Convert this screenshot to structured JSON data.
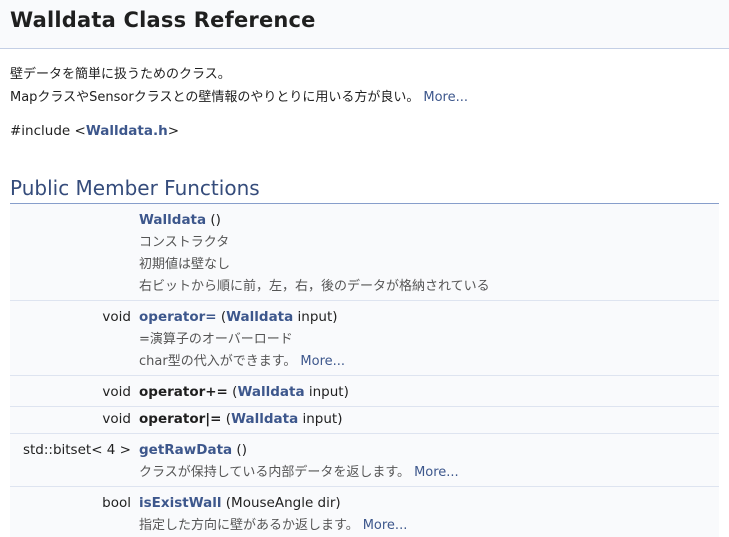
{
  "header": {
    "title": "Walldata Class Reference"
  },
  "brief": {
    "line1": "壁データを簡単に扱うためのクラス。",
    "line2": "MapクラスやSensorクラスとの壁情報のやりとりに用いる方が良い。",
    "more": "More..."
  },
  "include": {
    "prefix": "#include <",
    "file": "Walldata.h",
    "suffix": ">"
  },
  "section": {
    "title": "Public Member Functions"
  },
  "members": [
    {
      "type": "",
      "name": "Walldata",
      "args": " ()",
      "desc": [
        "コンストラクタ",
        "初期値は壁なし",
        "右ビットから順に前，左，右，後のデータが格納されている"
      ]
    },
    {
      "type": "void",
      "name": "operator=",
      "args_open": " (",
      "arg_type": "Walldata",
      "args_close": " input)",
      "desc": [
        "=演算子のオーバーロード",
        "char型の代入ができます。"
      ],
      "more": "More..."
    },
    {
      "type": "void",
      "name": "operator+=",
      "args_open": " (",
      "arg_type": "Walldata",
      "args_close": " input)"
    },
    {
      "type": "void",
      "name": "operator|=",
      "args_open": " (",
      "arg_type": "Walldata",
      "args_close": " input)"
    },
    {
      "type": "std::bitset< 4 >",
      "name": "getRawData",
      "args": " ()",
      "desc": [
        "クラスが保持している内部データを返します。"
      ],
      "more": "More..."
    },
    {
      "type": "bool",
      "name": "isExistWall",
      "args": " (MouseAngle dir)",
      "desc": [
        "指定した方向に壁があるか返します。"
      ],
      "more": "More..."
    }
  ]
}
